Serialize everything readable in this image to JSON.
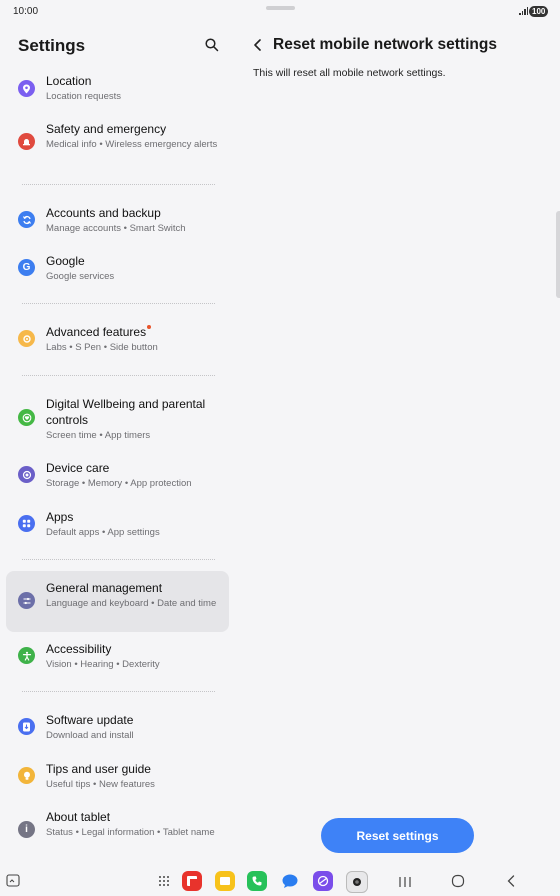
{
  "status": {
    "time": "10:00",
    "battery": "100"
  },
  "settings": {
    "title": "Settings",
    "items": [
      {
        "title": "Location",
        "sub": "Location requests",
        "color": "#7b5ff0"
      },
      {
        "title": "Safety and emergency",
        "sub": "Medical info  •  Wireless emergency alerts",
        "color": "#e04a3f"
      },
      {
        "title": "Accounts and backup",
        "sub": "Manage accounts  •  Smart Switch",
        "color": "#3d7ef0"
      },
      {
        "title": "Google",
        "sub": "Google services",
        "color": "#3d7ef0"
      },
      {
        "title": "Advanced features",
        "sub": "Labs  •  S Pen  •  Side button",
        "color": "#f6b84a"
      },
      {
        "title": "Digital Wellbeing and parental controls",
        "sub": "Screen time  •  App timers",
        "color": "#45b845"
      },
      {
        "title": "Device care",
        "sub": "Storage  •  Memory  •  App protection",
        "color": "#6b5fc8"
      },
      {
        "title": "Apps",
        "sub": "Default apps  •  App settings",
        "color": "#4a6ff0"
      },
      {
        "title": "General management",
        "sub": "Language and keyboard  •  Date and time",
        "color": "#6c6fa8"
      },
      {
        "title": "Accessibility",
        "sub": "Vision  •  Hearing  •  Dexterity",
        "color": "#3fb24a"
      },
      {
        "title": "Software update",
        "sub": "Download and install",
        "color": "#4a6ff0"
      },
      {
        "title": "Tips and user guide",
        "sub": "Useful tips  •  New features",
        "color": "#f2b53a"
      },
      {
        "title": "About tablet",
        "sub": "Status  •  Legal information  •  Tablet name",
        "color": "#757585"
      }
    ]
  },
  "panel": {
    "title": "Reset mobile network settings",
    "description": "This will reset all mobile network settings.",
    "button": "Reset settings"
  },
  "icons": {
    "search": "search-icon",
    "back": "chevron-left-icon",
    "location": "location-pin-icon",
    "safety": "siren-icon",
    "accounts": "sync-icon",
    "google": "google-icon",
    "advanced": "gear-plus-icon",
    "wellbeing": "heart-circle-icon",
    "device_care": "device-care-icon",
    "apps": "apps-grid-icon",
    "general": "sliders-icon",
    "accessibility": "accessibility-icon",
    "software": "update-icon",
    "tips": "lightbulb-icon",
    "about": "info-icon"
  },
  "accent": "#3e82f7"
}
